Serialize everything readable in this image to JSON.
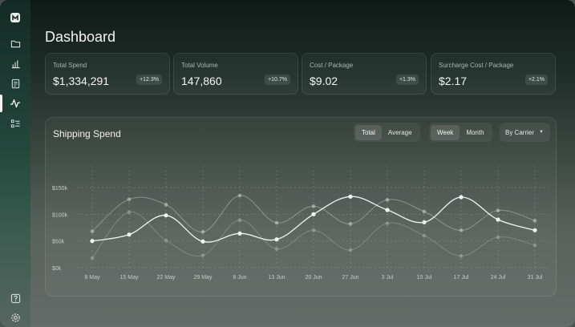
{
  "sidebar": {
    "icons": [
      {
        "name": "logo-icon"
      },
      {
        "name": "folder-icon"
      },
      {
        "name": "bar-chart-icon"
      },
      {
        "name": "document-icon"
      },
      {
        "name": "activity-icon"
      },
      {
        "name": "list-icon"
      },
      {
        "name": "help-icon"
      },
      {
        "name": "settings-icon"
      }
    ],
    "active": "activity-icon"
  },
  "page": {
    "title": "Dashboard"
  },
  "kpis": [
    {
      "label": "Total Spend",
      "value": "$1,334,291",
      "change": "+12.3%"
    },
    {
      "label": "Total Volume",
      "value": "147,860",
      "change": "+10.7%"
    },
    {
      "label": "Cost / Package",
      "value": "$9.02",
      "change": "+1.3%"
    },
    {
      "label": "Surcharge Cost / Package",
      "value": "$2.17",
      "change": "+2.1%"
    }
  ],
  "chart_panel": {
    "title": "Shipping Spend",
    "metric_toggle": [
      "Total",
      "Average"
    ],
    "metric_selected": "Total",
    "period_toggle": [
      "Week",
      "Month"
    ],
    "period_selected": "Week",
    "group_dropdown": "By Carrier"
  },
  "colors": {
    "accent_line": "#f2f4f3",
    "secondary_line": "#b8bfbb",
    "tertiary_line": "#9aa29e"
  },
  "chart_data": {
    "type": "line",
    "title": "",
    "xlabel": "",
    "ylabel": "",
    "categories": [
      "8 May",
      "15 May",
      "22 May",
      "29 May",
      "6 Jun",
      "13 Jun",
      "20 Jun",
      "27 Jun",
      "3 Jul",
      "10 Jul",
      "17 Jul",
      "24 Jul",
      "31 Jul"
    ],
    "ylim": [
      0,
      150000
    ],
    "yticks": [
      0,
      50000,
      100000,
      150000
    ],
    "ytick_labels": [
      "$0k",
      "$50k",
      "$100k",
      "$150k"
    ],
    "grid": true,
    "series": [
      {
        "values": [
          50000,
          62000,
          98000,
          49000,
          64000,
          53000,
          100000,
          133000,
          108000,
          85000,
          132000,
          90000,
          70000
        ]
      },
      {
        "values": [
          68000,
          128000,
          118000,
          67000,
          135000,
          84000,
          115000,
          82000,
          127000,
          105000,
          70000,
          107000,
          88000
        ]
      },
      {
        "values": [
          18000,
          104000,
          51000,
          23000,
          89000,
          35000,
          70000,
          33000,
          83000,
          60000,
          22000,
          57000,
          42000
        ]
      }
    ]
  }
}
